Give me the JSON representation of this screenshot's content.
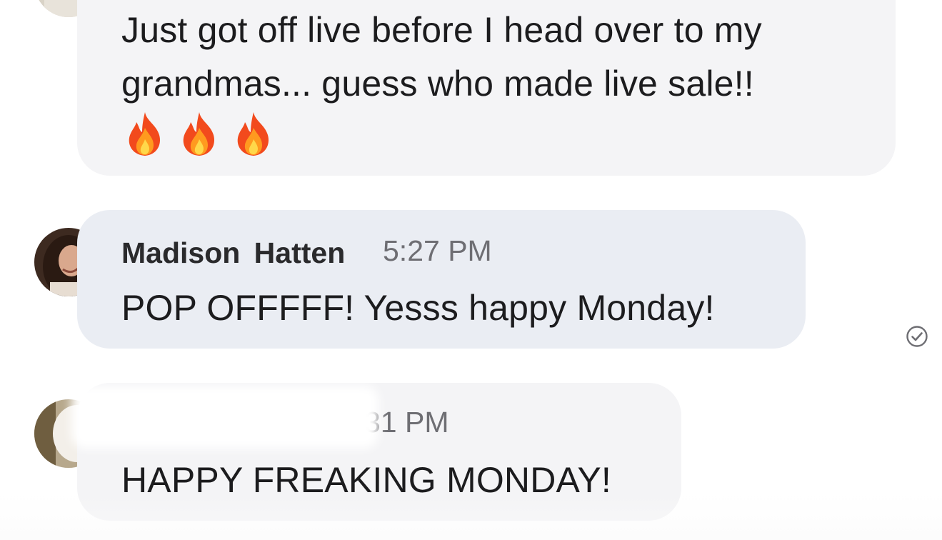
{
  "messages": [
    {
      "text_line1": "Just got off live before I head over to my",
      "text_line2": "grandmas... guess who made  live sale!!",
      "emoji_icons": [
        "fire-icon",
        "fire-icon",
        "fire-icon"
      ]
    },
    {
      "sender": "Madison  Hatten",
      "time": "5:27 PM",
      "text": "POP OFFFFF! Yesss happy Monday!",
      "status_icon": "read-check-icon"
    },
    {
      "time_partial": "31 PM",
      "text": "HAPPY FREAKING MONDAY!"
    }
  ],
  "colors": {
    "bubble_gray": "#f4f4f6",
    "bubble_blue": "#eaedf3",
    "text": "#1c1c1e",
    "timestamp": "#6e6e73"
  }
}
